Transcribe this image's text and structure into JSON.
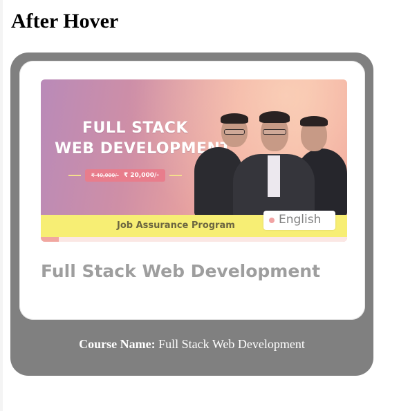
{
  "page": {
    "title": "After Hover"
  },
  "card": {
    "banner": {
      "line1": "FULL STACK",
      "line2": "WEB DEVELOPMENT",
      "price_old": "₹ 40,000/-",
      "price_new": "₹ 20,000/-",
      "strip_text": "Job Assurance Program",
      "language": "English"
    },
    "heading": "Full Stack Web Development",
    "caption_label": "Course Name:",
    "caption_value": "Full Stack Web Development"
  },
  "colors": {
    "outer_card": "#808080",
    "inner_card": "#ffffff",
    "heading_text": "#9e9e9e",
    "caption_text": "#ffffff"
  }
}
